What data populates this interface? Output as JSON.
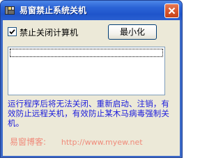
{
  "window": {
    "title": "易窗禁止系统关机",
    "icon": "app-icon",
    "close_icon": "close-icon"
  },
  "controls": {
    "checkbox_label": "禁止关闭计算机",
    "checkbox_checked": true,
    "minimize_label": "最小化"
  },
  "list": {
    "items": [
      ""
    ]
  },
  "info": {
    "text": "运行程序后将无法关闭、重新启动、注销，有效防止远程关机，有效防止某木马病毒强制关机。"
  },
  "footer": {
    "name": "易窗博客:",
    "url": "http://www.myew.net"
  },
  "colors": {
    "titlebar": "#2b63d6",
    "client_bg": "#ece9d8",
    "info_text": "#1a1adc",
    "footer_text": "#f08a7a",
    "close_button": "#d6542c"
  }
}
